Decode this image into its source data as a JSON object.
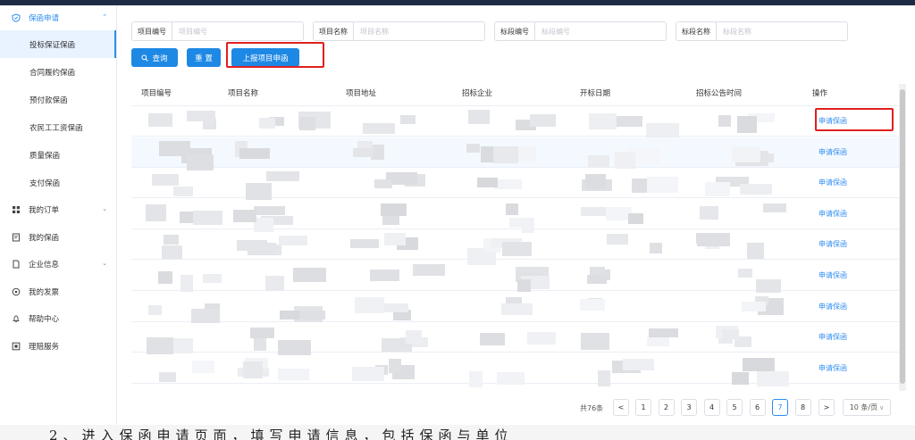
{
  "sidebar": {
    "group_apply": {
      "label": "保函申请",
      "icon": "shield-icon"
    },
    "sub_items": [
      "投标保证保函",
      "合同履约保函",
      "预付款保函",
      "农民工工资保函",
      "质量保函",
      "支付保函"
    ],
    "groups": [
      {
        "label": "我的订单",
        "icon": "grid-icon",
        "has_chevron": true
      },
      {
        "label": "我的保函",
        "icon": "document-icon",
        "has_chevron": false
      },
      {
        "label": "企业信息",
        "icon": "file-icon",
        "has_chevron": true
      },
      {
        "label": "我的发票",
        "icon": "invoice-icon",
        "has_chevron": false
      },
      {
        "label": "帮助中心",
        "icon": "bell-icon",
        "has_chevron": false
      },
      {
        "label": "理赔服务",
        "icon": "claim-icon",
        "has_chevron": false
      }
    ]
  },
  "filters": {
    "project_no": {
      "label": "项目编号",
      "placeholder": "项目编号"
    },
    "project_name": {
      "label": "项目名称",
      "placeholder": "项目名称"
    },
    "section_no": {
      "label": "标段编号",
      "placeholder": "标段编号"
    },
    "section_name": {
      "label": "标段名称",
      "placeholder": "标段名称"
    }
  },
  "buttons": {
    "search": "查询",
    "reset": "重 置",
    "report": "上报项目申函"
  },
  "table": {
    "headers": [
      "项目编号",
      "项目名称",
      "项目地址",
      "招标企业",
      "开标日期",
      "招标公告时间",
      "操作"
    ],
    "row_action": "申请保函",
    "row_count": 9
  },
  "pagination": {
    "total": "共76条",
    "prev": "<",
    "next": ">",
    "pages": [
      "1",
      "2",
      "3",
      "4",
      "5",
      "6",
      "7",
      "8"
    ],
    "current": "7",
    "page_size": "10 条/页"
  },
  "footer_text": "2、进入保函申请页面，填写申请信息，包括保函与单位"
}
